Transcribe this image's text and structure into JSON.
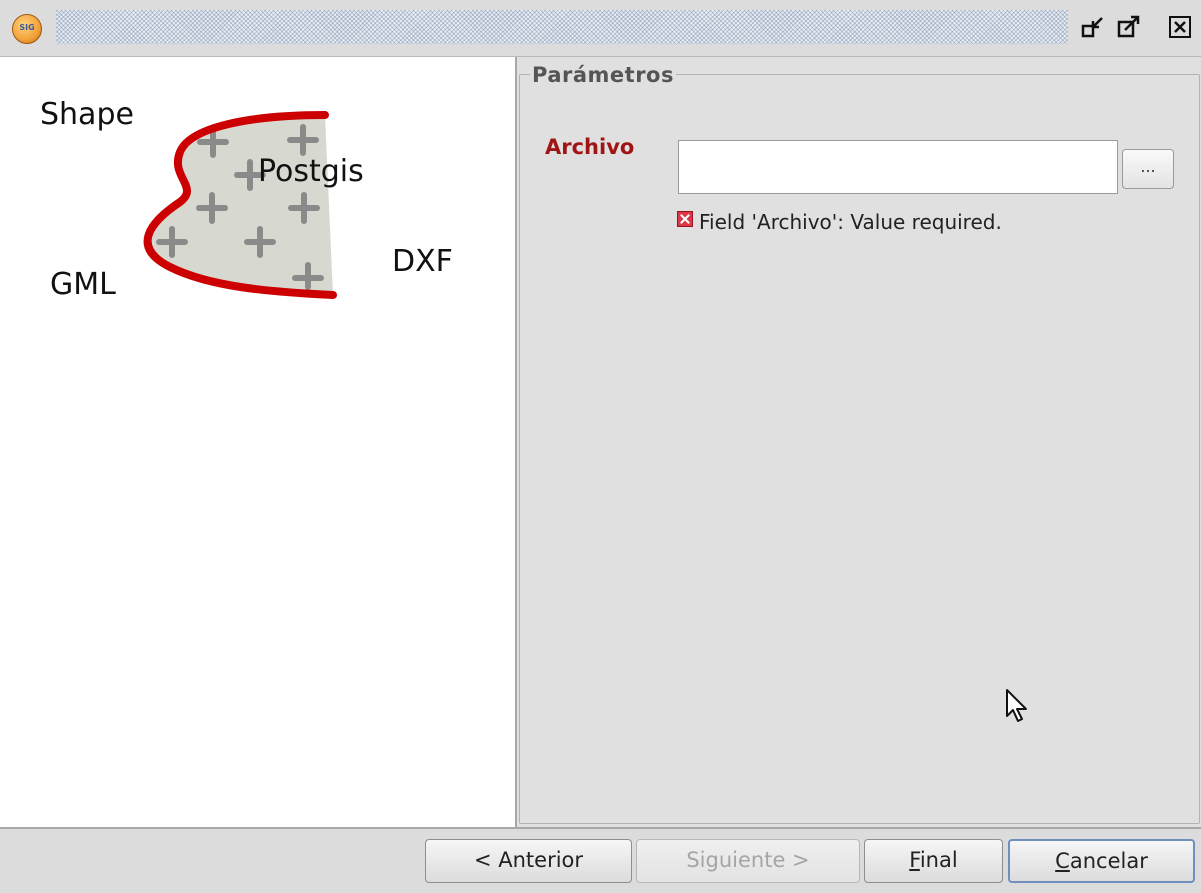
{
  "window": {
    "app_icon": "gvsig-icon",
    "app_icon_text": "SIG",
    "controls": [
      "restore-icon",
      "maximize-icon",
      "close-icon"
    ]
  },
  "illustration": {
    "labels": {
      "shape": "Shape",
      "postgis": "Postgis",
      "gml": "GML",
      "dxf": "DXF"
    },
    "colors": {
      "outline": "#cc0000",
      "fill": "#d7d9d1",
      "cross": "#8a8a8a"
    }
  },
  "params": {
    "legend": "Parámetros",
    "archivo_label": "Archivo",
    "archivo_value": "",
    "browse_label": "...",
    "error_text": "Field 'Archivo': Value required."
  },
  "footer": {
    "anterior": "< Anterior",
    "siguiente": "Siguiente >",
    "final_mn": "F",
    "final_rest": "inal",
    "cancelar_mn": "C",
    "cancelar_rest": "ancelar"
  }
}
